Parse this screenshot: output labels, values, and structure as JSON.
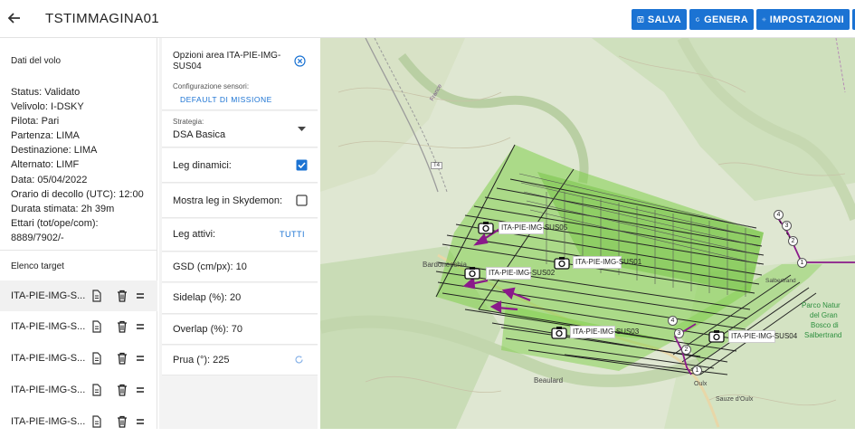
{
  "header": {
    "title": "TSTIMMAGINA01",
    "buttons": {
      "save": "SALVA",
      "generate": "GENERA",
      "settings": "IMPOSTAZIONI"
    }
  },
  "flight": {
    "heading": "Dati del volo",
    "lines": [
      "Status:  Validato",
      "Velivolo:  I-DSKY",
      "Pilota:  Pari",
      "Partenza:  LIMA",
      "Destinazione:  LIMA",
      "Alternato:  LIMF",
      "Data:  05/04/2022",
      "Orario di decollo (UTC):  12:00",
      "Durata stimata:  2h 39m",
      "Ettari (tot/ope/com):",
      "8889/7902/-"
    ]
  },
  "targets": {
    "heading": "Elenco target",
    "items": [
      "ITA-PIE-IMG-S...",
      "ITA-PIE-IMG-S...",
      "ITA-PIE-IMG-S...",
      "ITA-PIE-IMG-S...",
      "ITA-PIE-IMG-S..."
    ]
  },
  "options": {
    "title": "Opzioni area ITA-PIE-IMG-SUS04",
    "sensor_label": "Configurazione sensori:",
    "sensor_link": "DEFAULT DI MISSIONE",
    "strategy_label": "Strategia:",
    "strategy_value": "DSA Basica",
    "dynamic_legs": "Leg dinamici:",
    "dynamic_legs_checked": true,
    "show_skydemon": "Mostra leg in Skydemon:",
    "show_skydemon_checked": false,
    "active_legs": "Leg attivi:",
    "active_legs_link": "TUTTI",
    "gsd": "GSD (cm/px):  10",
    "sidelap": "Sidelap (%):  20",
    "overlap": "Overlap (%):  70",
    "heading": "Prua (°):  225"
  },
  "map": {
    "areas": [
      {
        "label": "ITA-PIE-IMG-SUS05"
      },
      {
        "label": "ITA-PIE-IMG-SUS01"
      },
      {
        "label": "ITA-PIE-IMG-SUS02"
      },
      {
        "label": "ITA-PIE-IMG-SUS03"
      },
      {
        "label": "ITA-PIE-IMG-SUS04"
      }
    ],
    "places": {
      "bardonecchia": "Bardonecchia",
      "beaulard": "Beaulard",
      "oulx": "Oulx",
      "sauze": "Sauze d'Oulx",
      "salbertrand": "Salbertrand",
      "france": "France",
      "t4": "T4",
      "park": [
        "Parco Natur",
        "del Gran",
        "Bosco di",
        "Salbertrand"
      ]
    },
    "waypoints_a": [
      "4",
      "3",
      "2",
      "1"
    ],
    "waypoints_b": [
      "4",
      "3",
      "2",
      "1"
    ],
    "colors": {
      "area_fill": "#7fcf4a",
      "legs": "#222222",
      "arrows": "#8a1a8a",
      "route": "#8a1a8a"
    }
  }
}
